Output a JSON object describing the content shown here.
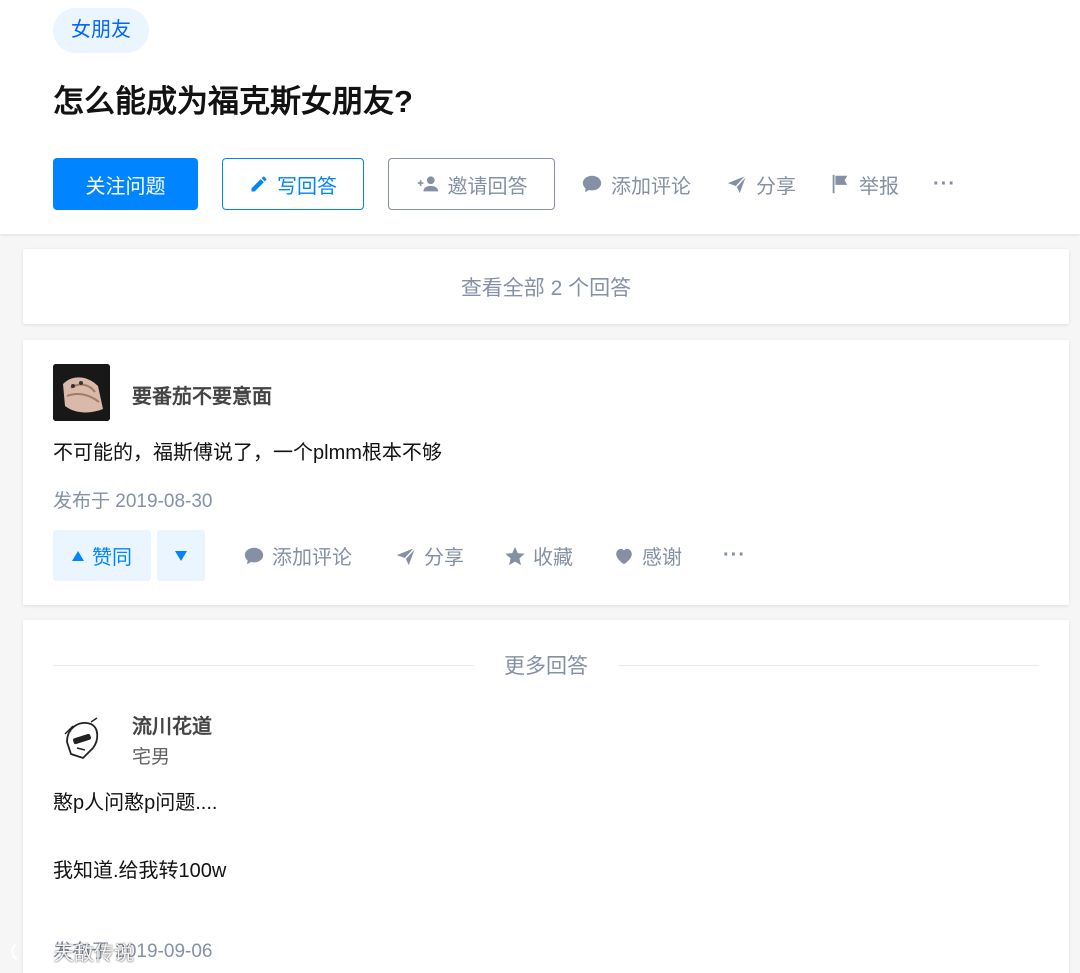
{
  "question": {
    "topic": "女朋友",
    "title": "怎么能成为福克斯女朋友?",
    "actions": {
      "follow": "关注问题",
      "write": "写回答",
      "invite": "邀请回答",
      "comment": "添加评论",
      "share": "分享",
      "report": "举报",
      "more": "···"
    }
  },
  "view_all": "查看全部 2 个回答",
  "answer1": {
    "author": "要番茄不要意面",
    "content": "不可能的，福斯傅说了，一个plmm根本不够",
    "date": "发布于 2019-08-30",
    "actions": {
      "upvote": "赞同",
      "comment": "添加评论",
      "share": "分享",
      "collect": "收藏",
      "thanks": "感谢",
      "more": "···"
    }
  },
  "more_answers": "更多回答",
  "answer2": {
    "author": "流川花道",
    "headline": "宅男",
    "line1": "憨p人问憨p问题....",
    "line2": "我知道.给我转100w",
    "date": "发布于 2019-09-06"
  },
  "watermark": "天敌传说",
  "colors": {
    "primary": "#0084ff",
    "meta": "#8590a6",
    "topic_bg": "#ebf5ff"
  }
}
